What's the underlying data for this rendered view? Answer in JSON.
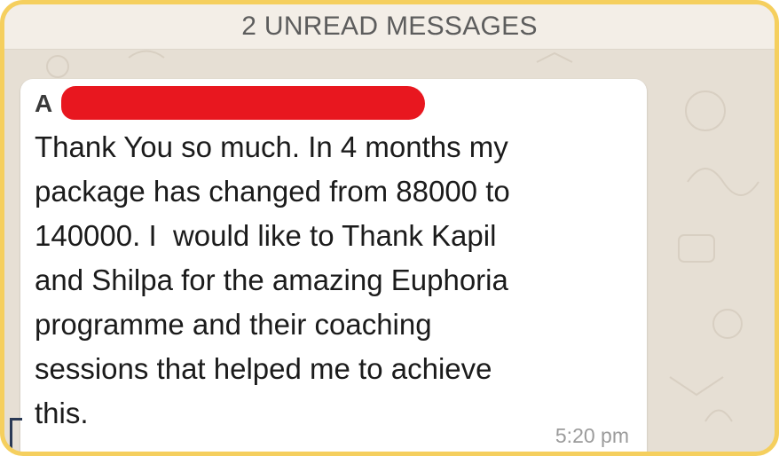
{
  "banner": {
    "text": "2 UNREAD MESSAGES"
  },
  "message": {
    "sender_initial": "A",
    "text": "Thank You so much. In 4 months my\npackage has changed from 88000 to\n140000. I  would like to Thank Kapil\nand Shilpa for the amazing Euphoria\nprogramme and their coaching\nsessions that helped me to achieve\nthis.",
    "time": "5:20 pm"
  },
  "colors": {
    "frame_border": "#f5cf5e",
    "redaction": "#e8171f",
    "bubble": "#ffffff",
    "wallpaper": "#e6dfd4"
  }
}
